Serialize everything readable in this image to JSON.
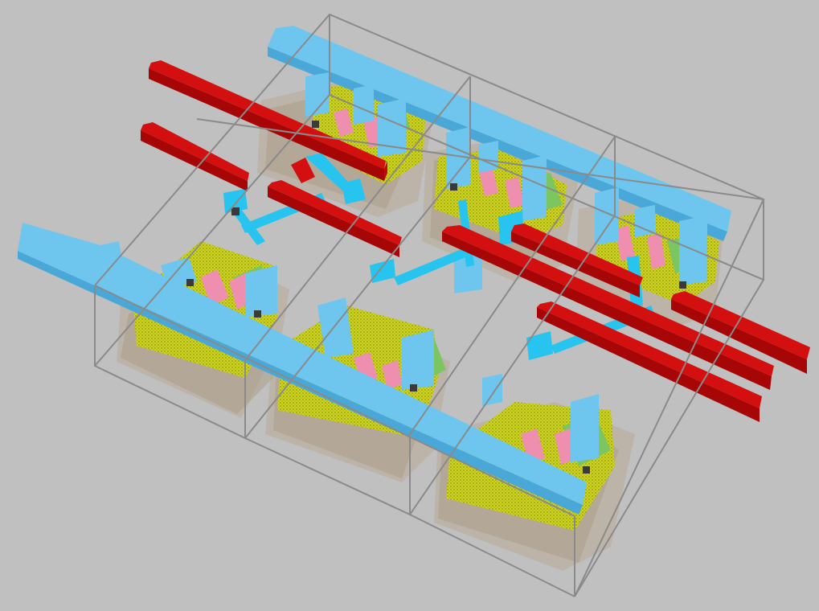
{
  "scene": {
    "kind": "3D standard-cell layout render",
    "colors": {
      "background": "#c0c0c0",
      "metal1": "#6ec6ee",
      "poly": "#ef8fb0",
      "metal2": "#d30f0f",
      "via": "#27c4ef",
      "active": "#d6d21a",
      "well": "#b8aa96",
      "cell_frame": "#8a8a8a"
    },
    "cells": 6,
    "rails": 3
  }
}
